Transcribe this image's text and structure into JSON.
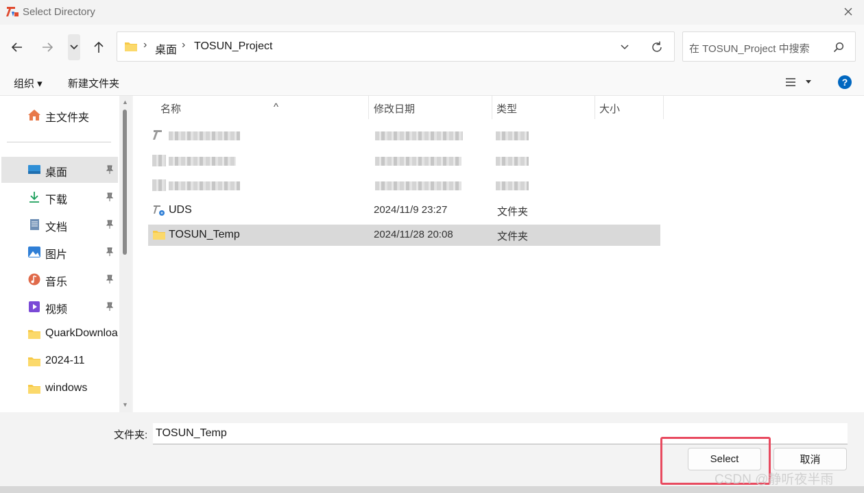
{
  "window": {
    "title": "Select Directory"
  },
  "nav": {
    "breadcrumb": [
      "桌面",
      "TOSUN_Project"
    ],
    "search_placeholder": "在 TOSUN_Project 中搜索"
  },
  "commands": {
    "organize": "组织 ▾",
    "new_folder": "新建文件夹"
  },
  "sidebar": {
    "home": "主文件夹",
    "items": [
      {
        "label": "桌面",
        "icon": "desktop-icon",
        "pinned": true,
        "selected": true
      },
      {
        "label": "下载",
        "icon": "download-icon",
        "pinned": true
      },
      {
        "label": "文档",
        "icon": "document-icon",
        "pinned": true
      },
      {
        "label": "图片",
        "icon": "pictures-icon",
        "pinned": true
      },
      {
        "label": "音乐",
        "icon": "music-icon",
        "pinned": true
      },
      {
        "label": "视频",
        "icon": "video-icon",
        "pinned": true
      },
      {
        "label": "QuarkDownloa",
        "icon": "folder-icon"
      },
      {
        "label": "2024-11",
        "icon": "folder-icon"
      },
      {
        "label": "windows",
        "icon": "folder-icon"
      }
    ]
  },
  "columns": {
    "name": "名称",
    "modified": "修改日期",
    "type": "类型",
    "size": "大小"
  },
  "files": [
    {
      "name": "UDS",
      "modified": "2024/11/9 23:27",
      "type": "文件夹"
    },
    {
      "name": "TOSUN_Temp",
      "modified": "2024/11/28 20:08",
      "type": "文件夹",
      "selected": true
    }
  ],
  "footer": {
    "folder_label": "文件夹:",
    "folder_value": "TOSUN_Temp",
    "select_button": "Select",
    "cancel_button": "取消"
  },
  "watermark": "CSDN @静听夜半雨",
  "colors": {
    "accent": "#0067c0",
    "highlight_box": "#e84a5f",
    "folder": "#f7c948"
  }
}
